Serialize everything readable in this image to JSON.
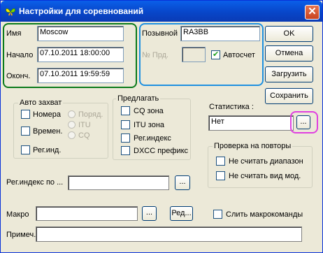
{
  "window": {
    "title": "Настройки для соревнований",
    "close": "✕"
  },
  "fields": {
    "name": {
      "label": "Имя",
      "value": "Moscow"
    },
    "start": {
      "label": "Начало",
      "value": "07.10.2011 18:00:00"
    },
    "end": {
      "label": "Оконч.",
      "value": "07.10.2011 19:59:59"
    },
    "callsign": {
      "label": "Позывной",
      "value": "RA3BB"
    },
    "prd": {
      "label": "№ Прд.",
      "value": ""
    },
    "autocount": {
      "label": "Автосчет",
      "checked": true
    }
  },
  "buttons": {
    "ok": "OK",
    "cancel": "Отмена",
    "load": "Загрузить",
    "save": "Сохранить",
    "stats_browse": "...",
    "region_browse": "...",
    "macro_browse": "...",
    "macro_edit": "Ред..."
  },
  "auto_capture": {
    "title": "Авто захват",
    "items": [
      {
        "label": "Номера",
        "checked": false
      },
      {
        "label": "Времен.",
        "checked": false
      },
      {
        "label": "Рег.инд.",
        "checked": false
      }
    ],
    "radios": [
      "Поряд.",
      "ITU",
      "CQ"
    ]
  },
  "suggest": {
    "title": "Предлагать",
    "items": [
      {
        "label": "CQ зона",
        "checked": false
      },
      {
        "label": "ITU зона",
        "checked": false
      },
      {
        "label": "Рег.индекс",
        "checked": false
      },
      {
        "label": "DXCC префикс",
        "checked": false
      }
    ]
  },
  "statistics": {
    "label": "Статистика :",
    "value": "Нет"
  },
  "repeat_check": {
    "title": "Проверка на повторы",
    "items": [
      {
        "label": "Не считать диапазон",
        "checked": false
      },
      {
        "label": "Не считать вид мод.",
        "checked": false
      }
    ]
  },
  "region_index": {
    "label": "Рег.индекс по ...",
    "value": ""
  },
  "macro": {
    "label": "Макро",
    "value": "",
    "merge_label": "Слить макрокоманды",
    "merge_checked": false
  },
  "note": {
    "label": "Примеч.",
    "value": ""
  },
  "colors": {
    "highlight_green": "#0a7a1a",
    "highlight_blue": "#1e90e0",
    "highlight_magenta": "#e040e0"
  }
}
